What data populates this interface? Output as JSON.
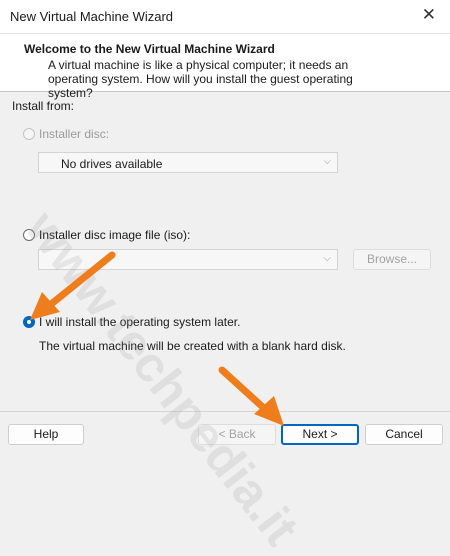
{
  "window": {
    "title": "New Virtual Machine Wizard"
  },
  "header": {
    "title": "Welcome to the New Virtual Machine Wizard",
    "description": "A virtual machine is like a physical computer; it needs an operating system. How will you install the guest operating system?"
  },
  "install_from": {
    "label": "Install from:",
    "options": [
      {
        "label": "Installer disc:",
        "selected": false,
        "enabled": false
      },
      {
        "label": "Installer disc image file (iso):",
        "selected": false,
        "enabled": true
      },
      {
        "label": "I will install the operating system later.",
        "selected": true,
        "enabled": true
      }
    ],
    "disc_drive_value": "No drives available",
    "iso_path_value": "",
    "browse_label": "Browse...",
    "later_note": "The virtual machine will be created with a blank hard disk."
  },
  "footer": {
    "help_label": "Help",
    "back_label": "< Back",
    "next_label": "Next >",
    "cancel_label": "Cancel"
  },
  "watermark": "www.techpedia.it",
  "colors": {
    "accent": "#0067c0",
    "annotation_arrow": "#f07d1c"
  }
}
